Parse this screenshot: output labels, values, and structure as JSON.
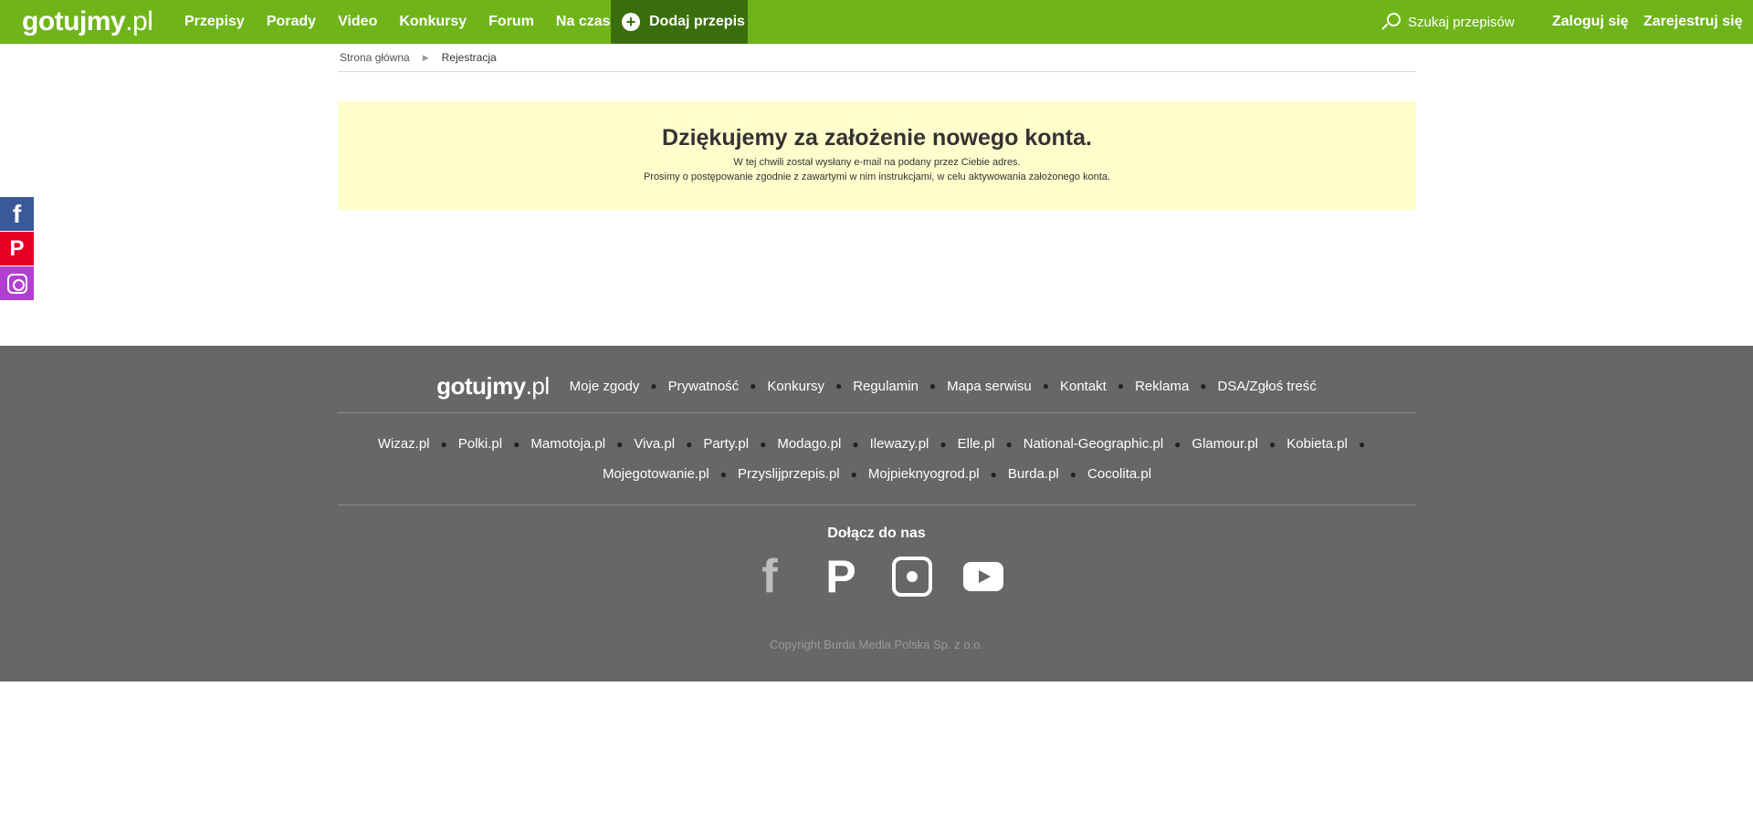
{
  "header": {
    "logo_main": "gotujmy",
    "logo_tld": ".pl",
    "nav": [
      {
        "label": "Przepisy"
      },
      {
        "label": "Porady"
      },
      {
        "label": "Video"
      },
      {
        "label": "Konkursy"
      },
      {
        "label": "Forum"
      },
      {
        "label": "Na czasie"
      }
    ],
    "add_recipe": "Dodaj przepis",
    "search_placeholder": "Szukaj przepisów",
    "login": "Zaloguj się",
    "register": "Zarejestruj się"
  },
  "breadcrumb": {
    "home": "Strona główna",
    "current": "Rejestracja"
  },
  "message": {
    "title": "Dziękujemy za założenie nowego konta.",
    "line1": "W tej chwili został wysłany e-mail na podany przez Ciebie adres.",
    "line2": "Prosimy o postępowanie zgodnie z zawartymi w nim instrukcjami, w celu aktywowania założonego konta."
  },
  "side_social": {
    "facebook": "f",
    "pinterest": "P"
  },
  "footer": {
    "logo_main": "gotujmy",
    "logo_tld": ".pl",
    "links": [
      "Moje zgody",
      "Prywatność",
      "Konkursy",
      "Regulamin",
      "Mapa serwisu",
      "Kontakt",
      "Reklama",
      "DSA/Zgłoś treść"
    ],
    "partners_row1": [
      "Wizaz.pl",
      "Polki.pl",
      "Mamotoja.pl",
      "Viva.pl",
      "Party.pl",
      "Modago.pl",
      "Ilewazy.pl",
      "Elle.pl",
      "National-Geographic.pl",
      "Glamour.pl",
      "Kobieta.pl"
    ],
    "partners_row2": [
      "Mojegotowanie.pl",
      "Przyslijprzepis.pl",
      "Mojpieknyogrod.pl",
      "Burda.pl",
      "Cocolita.pl"
    ],
    "join": "Dołącz do nas",
    "social_fb": "f",
    "social_pin": "P",
    "copyright": "Copyright Burda Media Polska Sp. z o.o."
  }
}
